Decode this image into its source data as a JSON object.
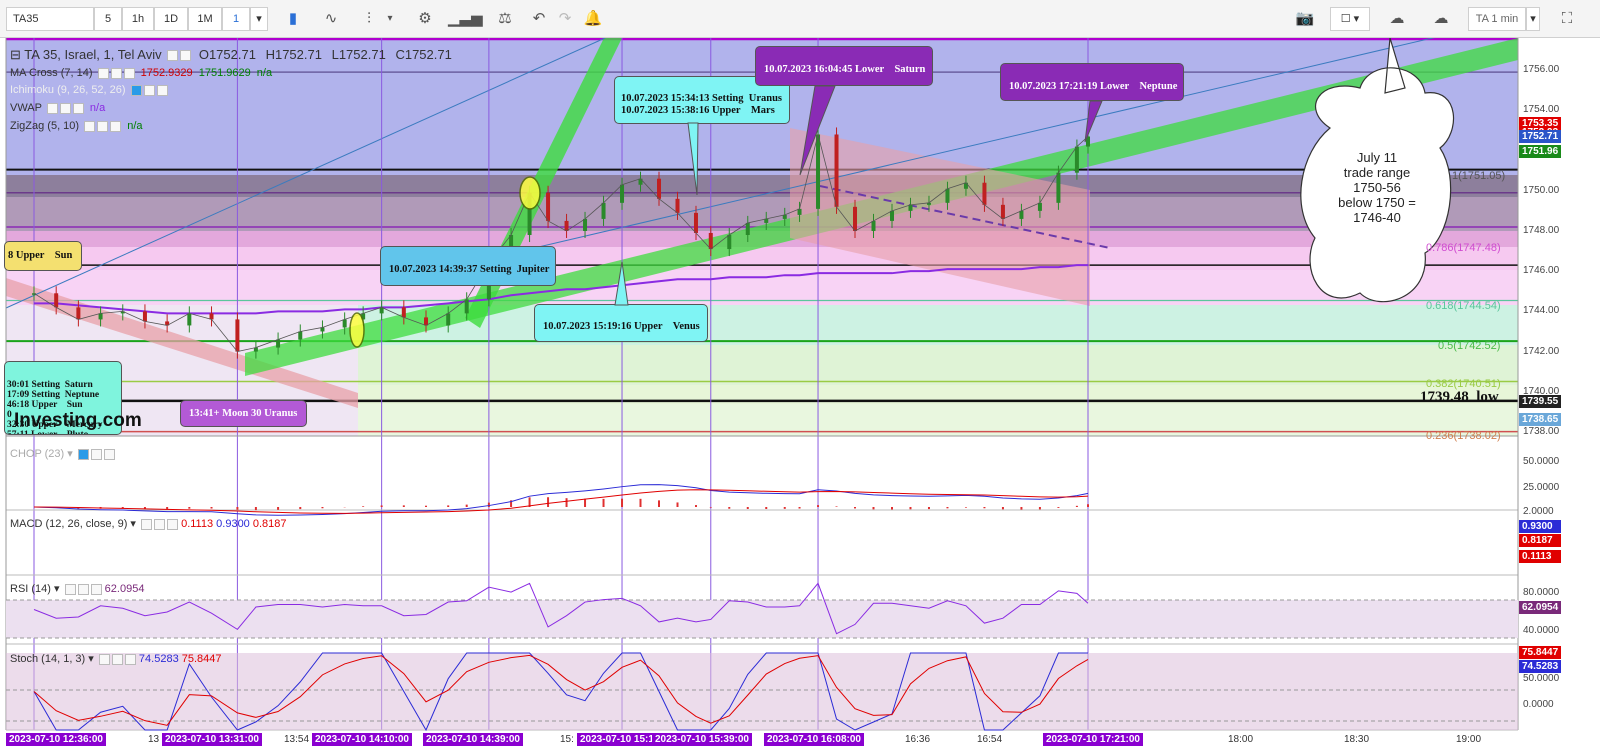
{
  "toolbar": {
    "symbol": "TA35",
    "intervals": [
      "5",
      "1h",
      "1D",
      "1M"
    ],
    "selected_interval": "1",
    "provider_button": "TA 1 min"
  },
  "legend": {
    "title": "TA 35, Israel, 1, Tel Aviv",
    "ohlc": [
      "O1752.71",
      "H1752.71",
      "L1752.71",
      "C1752.71"
    ],
    "indicators": [
      {
        "label": "MA Cross (7, 14)",
        "values": [
          "1752.9329",
          "1751.9629",
          "n/a"
        ],
        "colors": [
          "#d00000",
          "#008000",
          "#008000"
        ]
      },
      {
        "label": "Ichimoku (9, 26, 52, 26)",
        "values": [],
        "colors": []
      },
      {
        "label": "VWAP",
        "values": [
          "n/a"
        ],
        "colors": [
          "#8a2be2"
        ]
      },
      {
        "label": "ZigZag (5, 10)",
        "values": [
          "n/a"
        ],
        "colors": [
          "#008000"
        ]
      }
    ]
  },
  "price_axis": {
    "ticks": [
      "1756.00",
      "1754.00",
      "1752.00",
      "1750.00",
      "1748.00",
      "1746.00",
      "1744.00",
      "1742.00",
      "1740.00",
      "1738.00"
    ],
    "badges": [
      {
        "text": "1753.35",
        "color": "#e00000"
      },
      {
        "text": "1752.93",
        "color": "#e00000"
      },
      {
        "text": "1752.71",
        "color": "#2b55c9"
      },
      {
        "text": "1751.96",
        "color": "#1a8a1a"
      },
      {
        "text": "1739.55",
        "color": "#222222"
      },
      {
        "text": "1738.65",
        "color": "#6aa7d9"
      }
    ]
  },
  "fib_labels": [
    "1(1751.05)",
    "0.786(1747.48)",
    "0.618(1744.54)",
    "0.5(1742.52)",
    "0.382(1740.51)",
    "0.236(1738.02)"
  ],
  "low_label": {
    "value": "1739.48",
    "text": "low"
  },
  "callouts": [
    {
      "text": "10.07.2023 15:34:13 Setting  Uranus\n10.07.2023 15:38:16 Upper    Mars"
    },
    {
      "text": "10.07.2023 16:04:45 Lower    Saturn"
    },
    {
      "text": "10.07.2023 17:21:19 Lower    Neptune"
    },
    {
      "text": "10.07.2023 14:39:37 Setting  Jupiter"
    },
    {
      "text": "10.07.2023 15:19:16 Upper    Venus"
    },
    {
      "text": "13:41+ Moon 30 Uranus"
    },
    {
      "text": "8 Upper    Sun"
    },
    {
      "text": "30:01 Setting  Saturn\n17:09 Setting  Neptune\n46:18 Upper    Sun\n0\n32:30 Upper    Mercury\n57:11 Lower    Pluto"
    }
  ],
  "cloud_note": {
    "lines": [
      "July 11",
      "trade range",
      "1750-56",
      "below 1750 =",
      "1746-40"
    ]
  },
  "watermark": "Investing.com",
  "panels": {
    "chop": {
      "label": "CHOP (23)",
      "ticks": [
        "50.0000",
        "25.0000"
      ]
    },
    "macd": {
      "label": "MACD (12, 26, close, 9)",
      "values": [
        "0.1113",
        "0.9300",
        "0.8187"
      ],
      "ticks": [
        "2.0000"
      ],
      "badges": [
        {
          "text": "0.9300",
          "color": "#2b2bd6"
        },
        {
          "text": "0.8187",
          "color": "#e00000"
        },
        {
          "text": "0.1113",
          "color": "#e00000"
        }
      ]
    },
    "rsi": {
      "label": "RSI (14)",
      "value": "62.0954",
      "ticks": [
        "80.0000",
        "40.0000"
      ],
      "badges": [
        {
          "text": "62.0954",
          "color": "#7a2a7a"
        }
      ]
    },
    "stoch": {
      "label": "Stoch (14, 1, 3)",
      "values": [
        "74.5283",
        "75.8447"
      ],
      "ticks": [
        "50.0000",
        "0.0000"
      ],
      "badges": [
        {
          "text": "75.8447",
          "color": "#e00000"
        },
        {
          "text": "74.5283",
          "color": "#2b2bd6"
        }
      ]
    }
  },
  "time_axis": {
    "plain": [
      "13",
      "13:54",
      "15:",
      "16:36",
      "16:54",
      "18:00",
      "18:30",
      "19:00"
    ],
    "tags": [
      "2023-07-10 12:36:00",
      "2023-07-10 13:31:00",
      "2023-07-10 14:10:00",
      "2023-07-10 14:39:00",
      "2023-07-10 15:1!",
      "2023-07-10 15:39:00",
      "2023-07-10 16:08:00",
      "2023-07-10 17:21:00"
    ]
  },
  "chart_data": {
    "type": "candlestick",
    "title": "TA 35, Israel, 1, Tel Aviv",
    "ylim": [
      1737.8,
      1757.6
    ],
    "xlim": [
      "12:36",
      "19:10"
    ],
    "x": [
      "12:36",
      "12:42",
      "12:48",
      "12:54",
      "13:00",
      "13:06",
      "13:12",
      "13:18",
      "13:24",
      "13:31",
      "13:36",
      "13:42",
      "13:48",
      "13:54",
      "14:00",
      "14:05",
      "14:10",
      "14:16",
      "14:22",
      "14:28",
      "14:33",
      "14:39",
      "14:45",
      "14:50",
      "14:55",
      "15:00",
      "15:05",
      "15:10",
      "15:15",
      "15:20",
      "15:25",
      "15:30",
      "15:35",
      "15:39",
      "15:44",
      "15:49",
      "15:54",
      "15:59",
      "16:03",
      "16:08",
      "16:13",
      "16:18",
      "16:23",
      "16:28",
      "16:33",
      "16:38",
      "16:43",
      "16:48",
      "16:53",
      "16:58",
      "17:03",
      "17:08",
      "17:13",
      "17:18",
      "17:21"
    ],
    "close": [
      1744.9,
      1744.2,
      1743.6,
      1743.9,
      1744.0,
      1743.5,
      1743.3,
      1743.9,
      1743.6,
      1742.0,
      1742.2,
      1742.6,
      1743.0,
      1743.2,
      1743.6,
      1743.9,
      1744.2,
      1743.7,
      1743.3,
      1743.9,
      1744.6,
      1746.4,
      1747.8,
      1749.9,
      1748.5,
      1748.0,
      1748.6,
      1749.4,
      1750.3,
      1750.6,
      1749.6,
      1748.9,
      1747.9,
      1747.1,
      1747.8,
      1748.4,
      1748.6,
      1748.8,
      1749.1,
      1752.8,
      1749.2,
      1748.0,
      1748.5,
      1749.0,
      1749.3,
      1749.4,
      1750.1,
      1750.4,
      1749.3,
      1748.6,
      1749.0,
      1749.4,
      1750.9,
      1752.2,
      1752.7
    ],
    "vwap": [
      1744.4,
      1744.4,
      1744.3,
      1744.2,
      1744.1,
      1744.0,
      1743.9,
      1743.9,
      1743.9,
      1743.9,
      1743.9,
      1744.0,
      1744.0,
      1744.0,
      1744.1,
      1744.1,
      1744.2,
      1744.2,
      1744.3,
      1744.4,
      1744.5,
      1744.6,
      1744.8,
      1744.9,
      1745.0,
      1745.1,
      1745.1,
      1745.2,
      1745.3,
      1745.4,
      1745.5,
      1745.6,
      1745.6,
      1745.6,
      1745.7,
      1745.7,
      1745.7,
      1745.8,
      1745.8,
      1745.9,
      1745.9,
      1745.9,
      1745.9,
      1745.9,
      1746.0,
      1746.0,
      1746.1,
      1746.1,
      1746.1,
      1746.1,
      1746.1,
      1746.2,
      1746.2,
      1746.3,
      1746.3
    ],
    "fib_levels": [
      1751.05,
      1747.48,
      1744.54,
      1742.52,
      1740.51,
      1738.02
    ],
    "horizontal_lines": [
      1755.9,
      1751.05,
      1749.9,
      1748.2,
      1746.3,
      1744.54,
      1742.52,
      1740.51,
      1739.55,
      1738.02
    ],
    "vertical_time_markers": [
      "12:36",
      "13:31",
      "14:10",
      "14:39",
      "15:15",
      "15:39",
      "16:08",
      "17:21"
    ],
    "macd_last": {
      "hist": 0.1113,
      "macd": 0.93,
      "signal": 0.8187
    },
    "rsi_last": 62.0954,
    "stoch_last": {
      "k": 74.5283,
      "d": 75.8447
    }
  }
}
